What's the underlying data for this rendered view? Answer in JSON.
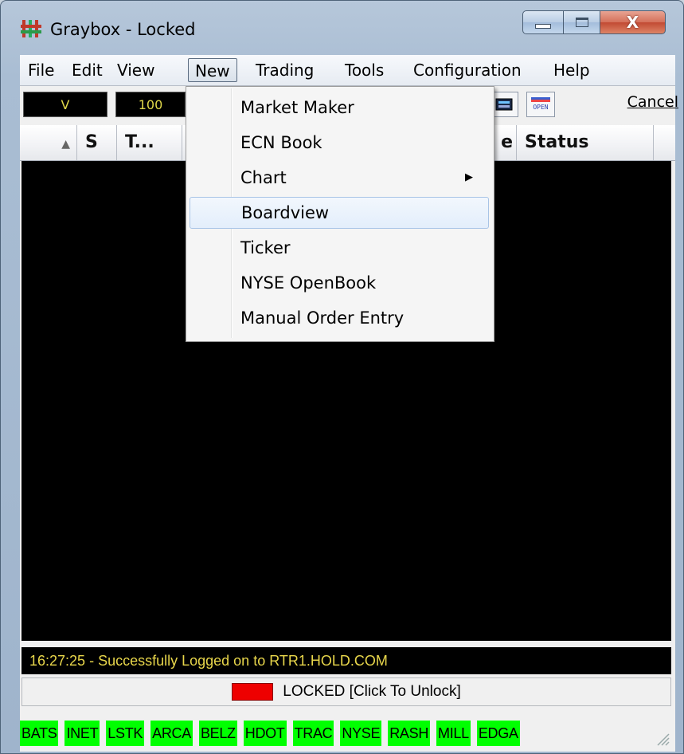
{
  "window": {
    "title": "Graybox - Locked",
    "close_glyph": "X"
  },
  "menubar": {
    "items": [
      "File",
      "Edit",
      "View",
      "New",
      "Trading",
      "Tools",
      "Configuration",
      "Help"
    ],
    "active": "New"
  },
  "toolbar": {
    "symbol": "V",
    "quantity": "100",
    "open_icon_label": "OPEN",
    "cancel_label": "Cancel"
  },
  "grid": {
    "columns": [
      "S",
      "T...",
      "Status"
    ],
    "partial_column": "e"
  },
  "new_menu": {
    "items": [
      "Market Maker",
      "ECN Book",
      "Chart",
      "Boardview",
      "Ticker",
      "NYSE OpenBook",
      "Manual Order Entry"
    ],
    "hover_item": "Boardview",
    "submenu_item": "Chart"
  },
  "status": {
    "message": "16:27:25 - Successfully Logged on to RTR1.HOLD.COM",
    "lock_text": "LOCKED [Click To Unlock]",
    "lock_color": "#ee0000"
  },
  "ecn_routes": [
    "BATS",
    "INET",
    "LSTK",
    "ARCA",
    "BELZ",
    "HDOT",
    "TRAC",
    "NYSE",
    "RASH",
    "MILL",
    "EDGA"
  ],
  "colors": {
    "ecn_bg": "#00ff00",
    "status_text": "#e8d64b"
  }
}
